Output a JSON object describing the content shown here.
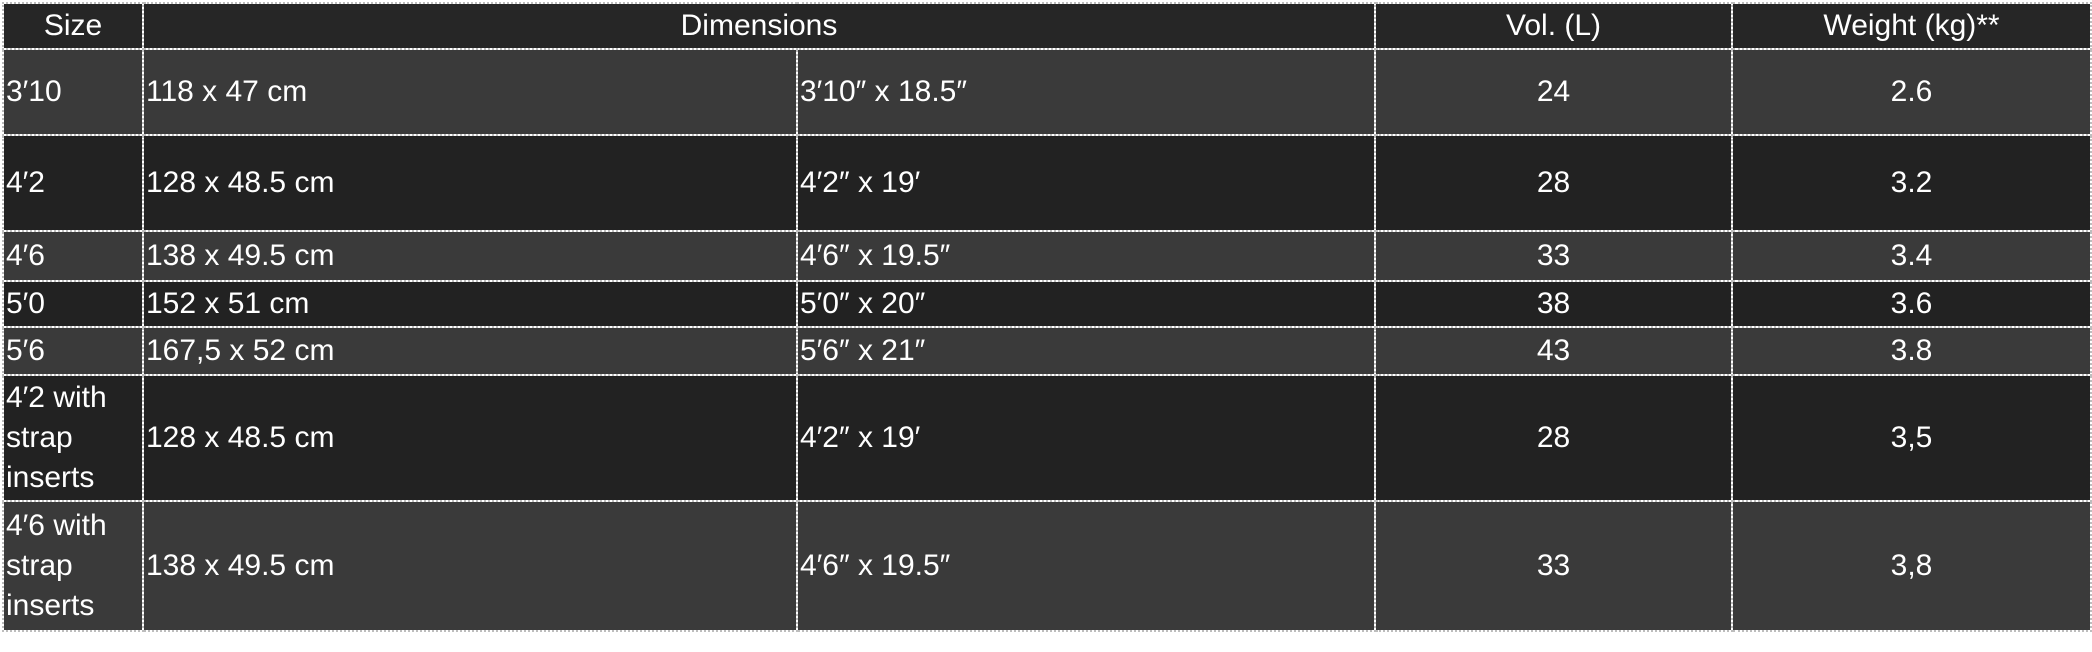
{
  "table": {
    "headers": {
      "size": "Size",
      "dimensions": "Dimensions",
      "volume": "Vol. (L)",
      "weight": "Weight (kg)**"
    },
    "rows": [
      {
        "size": "3′10",
        "metric": "118 x 47 cm",
        "imperial": "3′10″ x 18.5″",
        "volume": "24",
        "weight": "2.6"
      },
      {
        "size": "4′2",
        "metric": "128 x 48.5 cm",
        "imperial": "4′2″ x 19′",
        "volume": "28",
        "weight": "3.2"
      },
      {
        "size": "4′6",
        "metric": "138 x 49.5 cm",
        "imperial": "4′6″ x 19.5″",
        "volume": "33",
        "weight": "3.4"
      },
      {
        "size": "5′0",
        "metric": "152 x 51 cm",
        "imperial": "5′0″ x 20″",
        "volume": "38",
        "weight": "3.6"
      },
      {
        "size": "5′6",
        "metric": "167,5 x 52 cm",
        "imperial": "5′6″ x 21″",
        "volume": "43",
        "weight": "3.8"
      },
      {
        "size": "4′2 with strap inserts",
        "metric": "128 x 48.5 cm",
        "imperial": "4′2″ x 19′",
        "volume": "28",
        "weight": "3,5"
      },
      {
        "size": "4′6 with strap inserts",
        "metric": "138 x 49.5 cm",
        "imperial": "4′6″ x 19.5″",
        "volume": "33",
        "weight": "3,8"
      }
    ]
  }
}
